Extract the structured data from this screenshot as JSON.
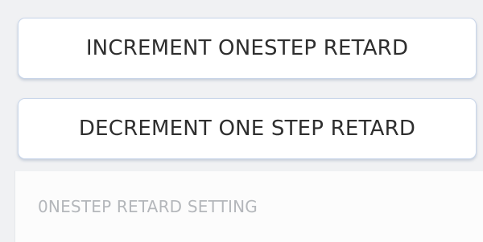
{
  "controls": {
    "increment_label": "INCREMENT ONESTEP RETARD",
    "decrement_label": "DECREMENT ONE STEP RETARD",
    "setting_placeholder": "0NESTEP RETARD SETTING"
  }
}
